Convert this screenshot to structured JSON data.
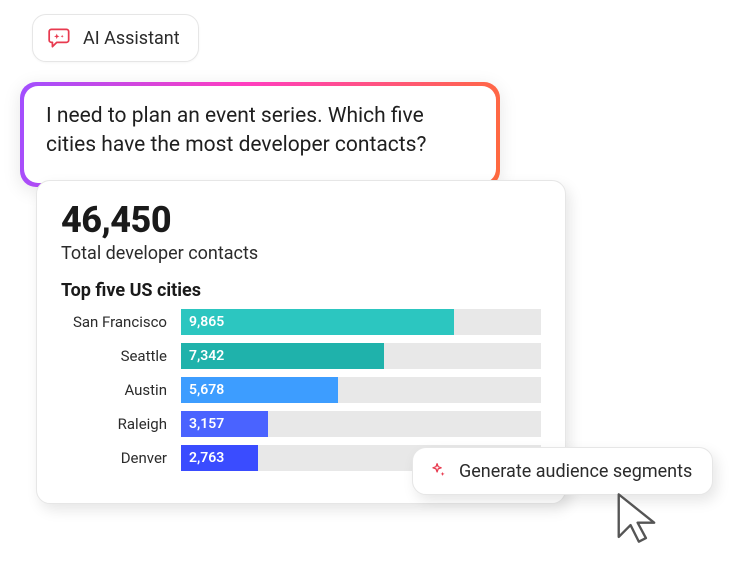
{
  "assistant": {
    "label": "AI Assistant"
  },
  "prompt": {
    "text": "I need to plan an event series. Which five cities have the most developer contacts?"
  },
  "results": {
    "total_value": "46,450",
    "total_label": "Total developer contacts",
    "section_title": "Top five US cities"
  },
  "generate": {
    "label": "Generate audience segments"
  },
  "colors": {
    "accent_red": "#e83a4f",
    "bar_track": "#e8e8e8"
  },
  "chart_data": {
    "type": "bar",
    "orientation": "horizontal",
    "title": "Top five US cities",
    "xlabel": "",
    "ylabel": "",
    "xlim": [
      0,
      13000
    ],
    "categories": [
      "San Francisco",
      "Seattle",
      "Austin",
      "Raleigh",
      "Denver"
    ],
    "values": [
      9865,
      7342,
      5678,
      3157,
      2763
    ],
    "value_labels": [
      "9,865",
      "7,342",
      "5,678",
      "3,157",
      "2,763"
    ],
    "bar_colors": [
      "#2cc6c0",
      "#1fb2ab",
      "#3d9dff",
      "#4a63ff",
      "#3a4cff"
    ]
  }
}
